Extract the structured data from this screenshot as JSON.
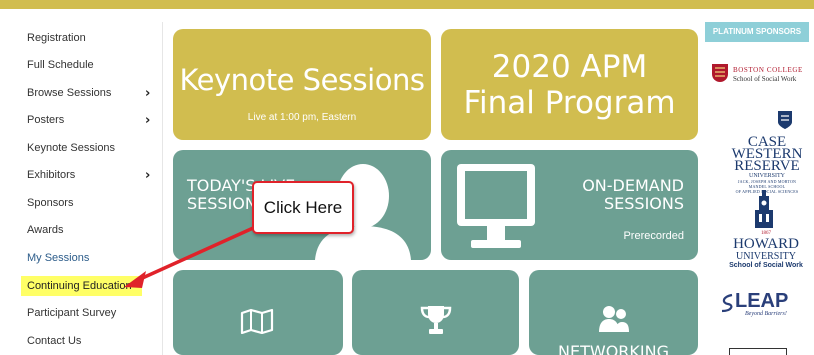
{
  "theme": {
    "gold": "#d1bd4f",
    "teal": "#6da093",
    "sponsor_header_bg": "#8ecfd8",
    "highlight": "#ffff66",
    "callout_red": "#e0222a"
  },
  "sidebar": {
    "items": [
      {
        "label": "Registration",
        "has_submenu": false
      },
      {
        "label": "Full Schedule",
        "has_submenu": false
      },
      {
        "label": "Browse Sessions",
        "has_submenu": true
      },
      {
        "label": "Posters",
        "has_submenu": true
      },
      {
        "label": "Keynote Sessions",
        "has_submenu": false
      },
      {
        "label": "Exhibitors",
        "has_submenu": true
      },
      {
        "label": "Sponsors",
        "has_submenu": false
      },
      {
        "label": "Awards",
        "has_submenu": false
      },
      {
        "label": "My Sessions",
        "has_submenu": false,
        "state": "active"
      },
      {
        "label": "Continuing Education",
        "has_submenu": false,
        "state": "highlighted"
      },
      {
        "label": "Participant Survey",
        "has_submenu": false
      },
      {
        "label": "Contact Us",
        "has_submenu": false
      }
    ],
    "chevron_glyph": "›"
  },
  "tiles": {
    "keynote": {
      "title": "Keynote Sessions",
      "subtitle": "Live at 1:00 pm, Eastern",
      "icon": "none"
    },
    "program": {
      "line1": "2020 APM",
      "line2": "Final Program"
    },
    "todays_live": {
      "line1": "TODAY'S LIVE",
      "line2": "SESSIONS",
      "icon": "person-silhouette-icon"
    },
    "on_demand": {
      "line1": "ON-DEMAND",
      "line2": "SESSIONS",
      "line3": "Prerecorded",
      "icon": "monitor-icon"
    },
    "map": {
      "icon": "map-icon"
    },
    "awards": {
      "icon": "trophy-icon"
    },
    "networking": {
      "label": "NETWORKING",
      "icon": "people-icon"
    }
  },
  "annotation": {
    "callout_text": "Click Here",
    "points_to": "Continuing Education"
  },
  "sponsors": {
    "header": "PLATINUM SPONSORS",
    "boston_college": {
      "name": "BOSTON COLLEGE",
      "sub": "School of Social Work"
    },
    "case_western": {
      "line1": "CASE",
      "line2": "WESTERN",
      "line3": "RESERVE",
      "line4": "UNIVERSITY",
      "line5": "JACK, JOSEPH AND MORTON",
      "line6": "MANDEL SCHOOL",
      "line7": "OF APPLIED SOCIAL SCIENCES"
    },
    "howard": {
      "year": "1867",
      "name": "HOWARD",
      "uni": "UNIVERSITY",
      "school": "School of Social Work"
    },
    "leap": {
      "name": "LEAP",
      "tagline": "Beyond Barriers!"
    }
  }
}
